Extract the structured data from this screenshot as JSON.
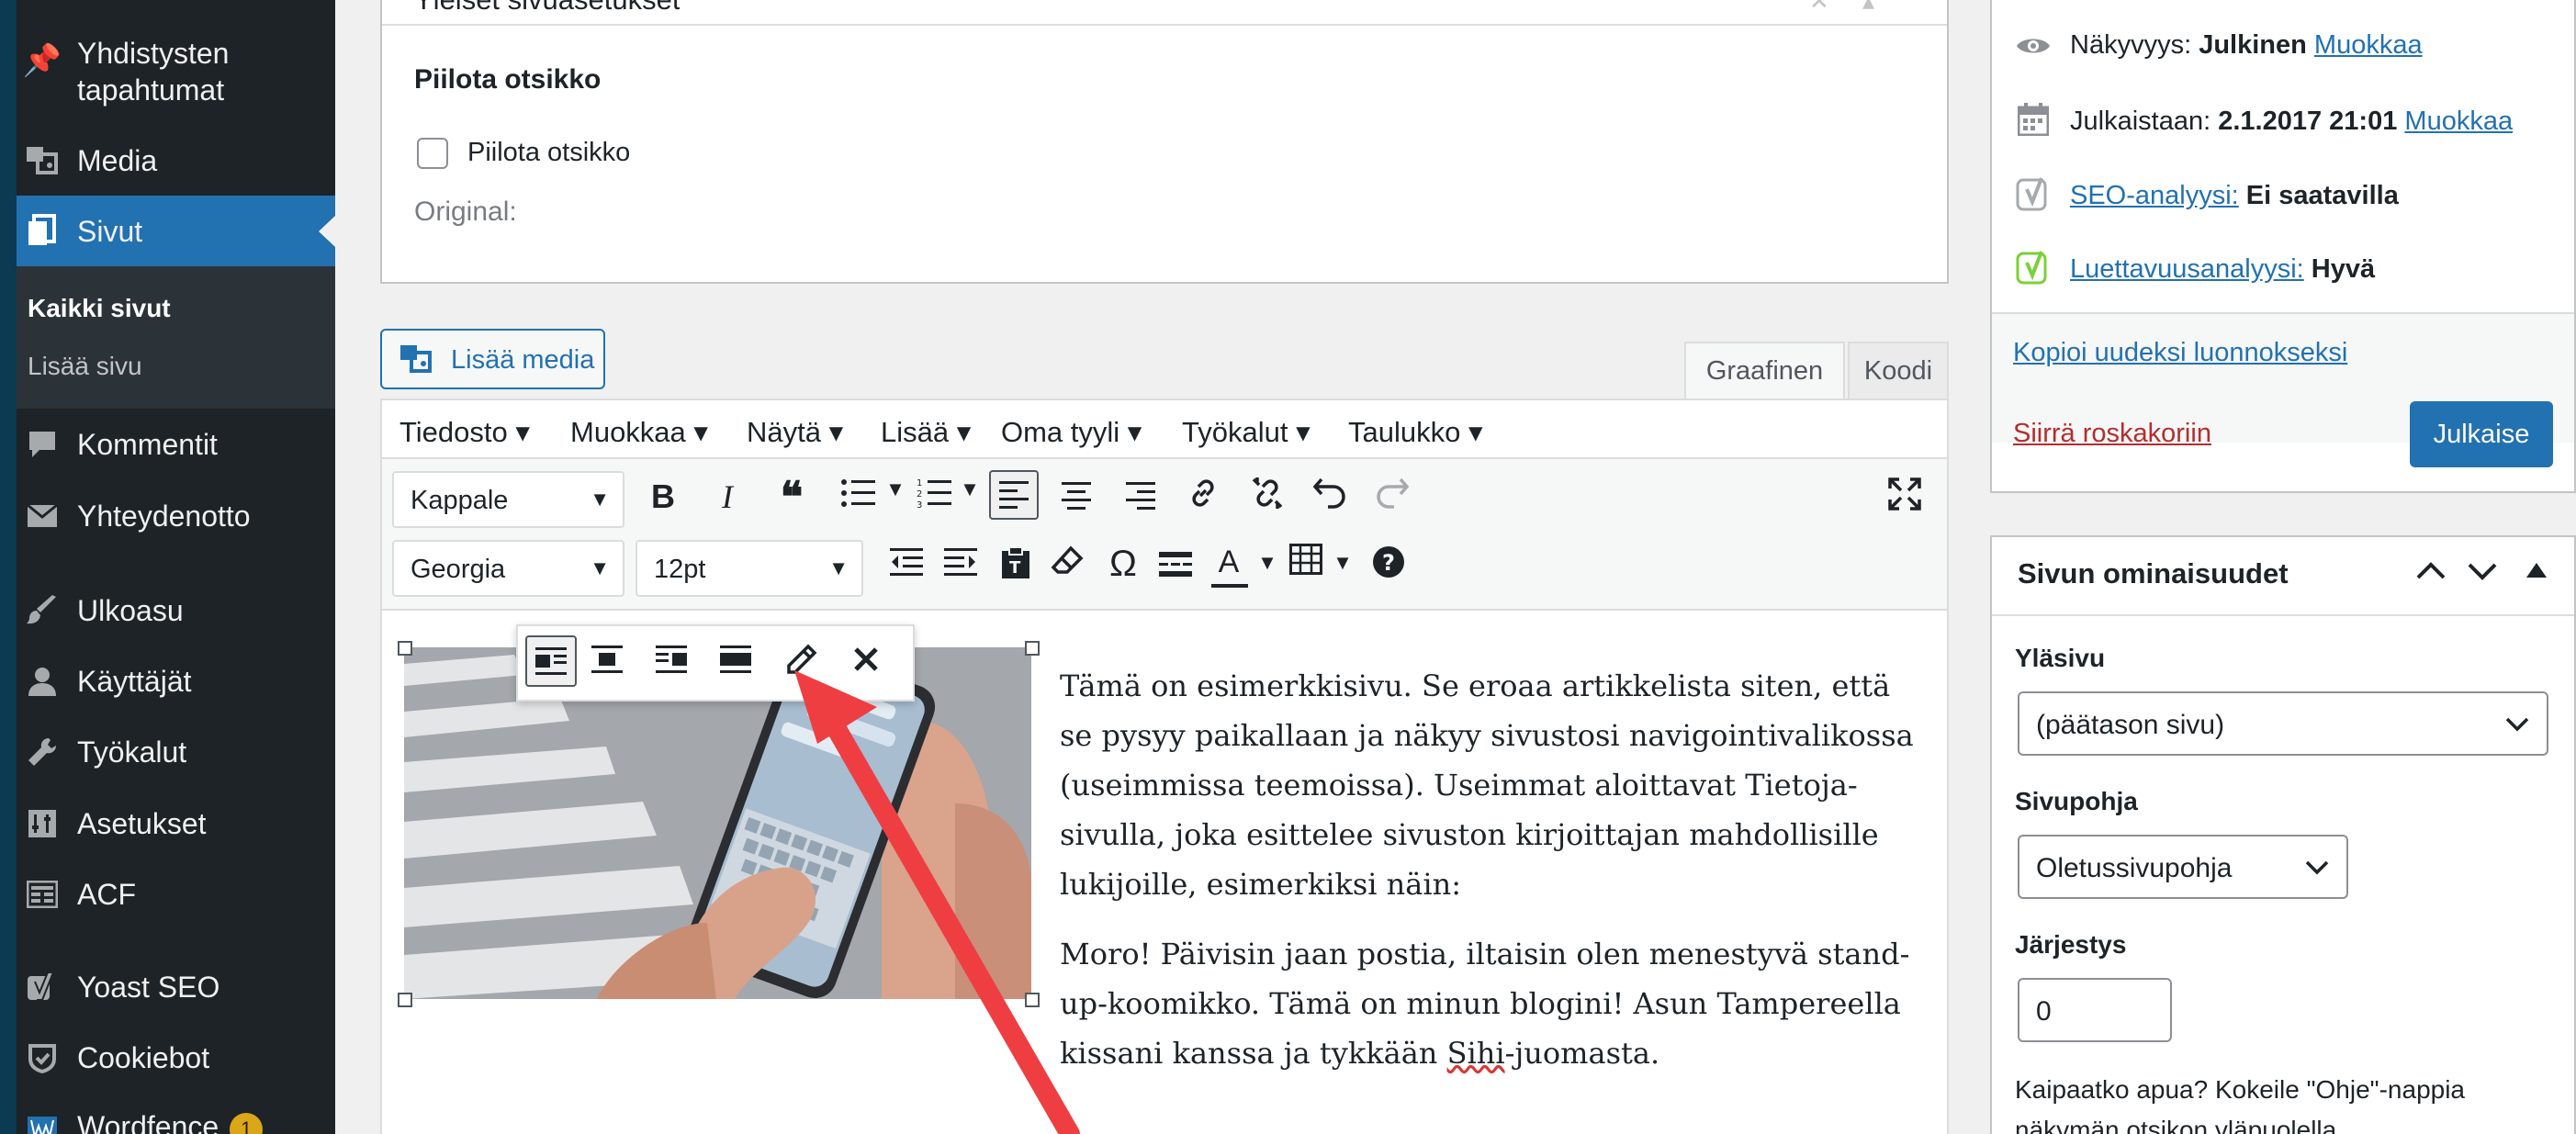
{
  "sidebar": {
    "items": [
      {
        "label": "Yhdistysten",
        "label2": "tapahtumat",
        "icon": "pin-icon"
      },
      {
        "label": "Media",
        "icon": "media-icon"
      },
      {
        "label": "Sivut",
        "icon": "pages-icon"
      },
      {
        "label": "Kommentit",
        "icon": "comments-icon"
      },
      {
        "label": "Yhteydenotto",
        "icon": "mail-icon"
      },
      {
        "label": "Ulkoasu",
        "icon": "brush-icon"
      },
      {
        "label": "Käyttäjät",
        "icon": "user-icon"
      },
      {
        "label": "Työkalut",
        "icon": "wrench-icon"
      },
      {
        "label": "Asetukset",
        "icon": "settings-icon"
      },
      {
        "label": "ACF",
        "icon": "acf-icon"
      },
      {
        "label": "Yoast SEO",
        "icon": "yoast-icon"
      },
      {
        "label": "Cookiebot",
        "icon": "cookiebot-icon"
      },
      {
        "label": "Wordfence",
        "icon": "wordfence-icon",
        "badge": "1"
      }
    ],
    "submenu": [
      "Kaikki sivut",
      "Lisää sivu"
    ]
  },
  "general_settings": {
    "title": "Yleiset sivuasetukset",
    "hide_title_heading": "Piilota otsikko",
    "hide_title_checkbox_label": "Piilota otsikko",
    "original_label": "Original:"
  },
  "editor": {
    "add_media": "Lisää media",
    "tab_visual": "Graafinen",
    "tab_code": "Koodi",
    "menubar": [
      "Tiedosto",
      "Muokkaa",
      "Näytä",
      "Lisää",
      "Oma tyyli",
      "Työkalut",
      "Taulukko"
    ],
    "format_select": "Kappale",
    "font_select": "Georgia",
    "size_select": "12pt",
    "paragraph1": "Tämä on esimerkkisivu. Se eroaa artikkelista siten, että se pysyy paikallaan ja näkyy sivustosi navigointivalikossa (useimmissa teemoissa). Useimmat aloittavat Tietoja-sivulla, joka esittelee sivuston kirjoittajan mahdollisille lukijoille, esimerkiksi näin:",
    "paragraph2a": "Moro! Päivisin jaan postia, iltaisin olen menestyvä stand-up-koomikko. Tämä on minun blogini! Asun Tampereella kissani kanssa ja tykkään ",
    "paragraph2_misspelled": "Sihi",
    "paragraph2b": "-juomasta."
  },
  "publish": {
    "visibility_label": "Näkyvyys:",
    "visibility_value": "Julkinen",
    "visibility_edit": "Muokkaa",
    "publish_label": "Julkaistaan:",
    "publish_value": "2.1.2017 21:01",
    "publish_edit": "Muokkaa",
    "seo_link": "SEO-analyysi:",
    "seo_value": "Ei saatavilla",
    "readability_link": "Luettavuusanalyysi:",
    "readability_value": "Hyvä",
    "copy_draft": "Kopioi uudeksi luonnokseksi",
    "trash": "Siirrä roskakoriin",
    "publish_button": "Julkaise"
  },
  "page_attributes": {
    "title": "Sivun ominaisuudet",
    "parent_label": "Yläsivu",
    "parent_value": "(päätason sivu)",
    "template_label": "Sivupohja",
    "template_value": "Oletussivupohja",
    "order_label": "Järjestys",
    "order_value": "0",
    "help_text1": "Kaipaatko apua? Kokeile \"Ohje\"-nappia",
    "help_text2": "näkymän otsikon yläpuolella."
  },
  "colors": {
    "sidebar_bg": "#1d2327",
    "active_menu": "#2271b1",
    "arrow": "#ef3e42",
    "primary_button": "#2271b1",
    "trash_link": "#b32d2e"
  }
}
